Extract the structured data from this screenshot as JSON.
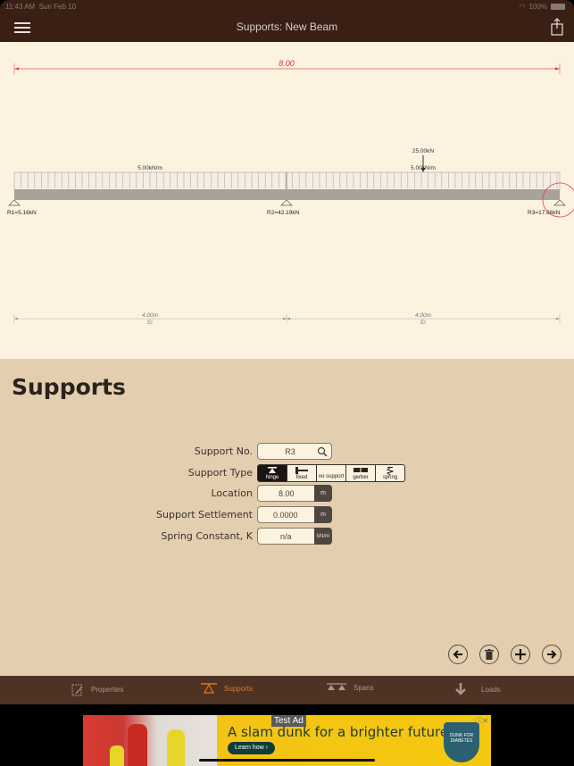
{
  "status_bar": {
    "time": "11:43 AM",
    "date": "Sun Feb 10",
    "battery": "100%"
  },
  "header": {
    "title": "Supports: New Beam",
    "menu_icon": "hamburger-icon",
    "share_icon": "share-icon"
  },
  "diagram": {
    "total_length_label": "8.00",
    "distributed_loads": [
      {
        "label": "5.00kN/m",
        "span": 1
      },
      {
        "label": "5.00kN/m",
        "span": 2
      }
    ],
    "point_load": {
      "label": "25.00kN"
    },
    "reactions": [
      {
        "label": "R1=5.16kN"
      },
      {
        "label": "R2=42.19kN"
      },
      {
        "label": "R3=17.66kN",
        "selected": true
      }
    ],
    "spans": [
      {
        "length_label": "4.00m",
        "stiffness_label": "EI"
      },
      {
        "length_label": "4.00m",
        "stiffness_label": "EI"
      }
    ]
  },
  "panel": {
    "title": "Supports",
    "form": {
      "support_no": {
        "label": "Support No.",
        "value": "R3",
        "icon": "search-icon"
      },
      "support_type": {
        "label": "Support Type",
        "options": [
          {
            "label": "hinge",
            "active": true
          },
          {
            "label": "fixed",
            "active": false
          },
          {
            "label": "no support",
            "active": false
          },
          {
            "label": "gerber",
            "active": false
          },
          {
            "label": "spring",
            "active": false
          }
        ]
      },
      "location": {
        "label": "Location",
        "value": "8.00",
        "unit": "m"
      },
      "settlement": {
        "label": "Support Settlement",
        "value": "0.0000",
        "unit": "m"
      },
      "spring_constant": {
        "label": "Spring Constant, K",
        "value": "n/a",
        "unit": "kN/m"
      }
    },
    "actions": [
      "previous",
      "delete",
      "add",
      "next"
    ]
  },
  "tabbar": {
    "tabs": [
      {
        "label": "Properties",
        "active": false
      },
      {
        "label": "Supports",
        "active": true
      },
      {
        "label": "Spans",
        "active": false
      },
      {
        "label": "Loads",
        "active": false
      }
    ],
    "active_color": "#e07b1a"
  },
  "ad": {
    "label": "Test Ad",
    "headline": "A slam dunk for a brighter future.",
    "cta": "Learn how ›",
    "badge": "DUNK FOR DIABETES"
  },
  "colors": {
    "header_bg": "#3a1f15",
    "canvas_bg": "#fcf2e0",
    "panel_bg": "#e3ceb0",
    "tabbar_bg": "#4e3224",
    "dimension_red": "#e03030"
  }
}
